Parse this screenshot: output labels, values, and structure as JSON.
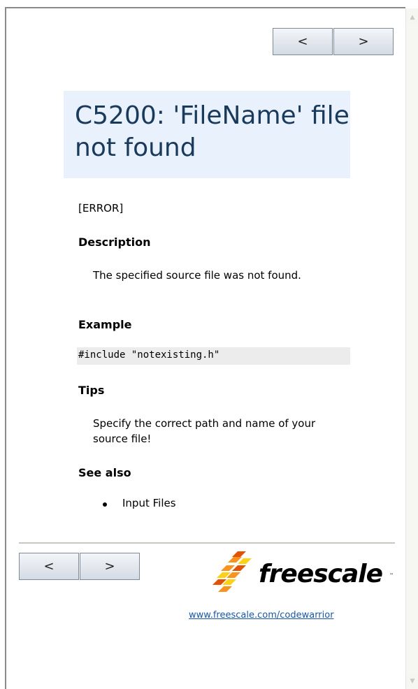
{
  "nav": {
    "prev_label": "<",
    "next_label": ">"
  },
  "title": "C5200: 'FileName' file not found",
  "error_tag": "[ERROR]",
  "description": {
    "heading": "Description",
    "text": "The specified source file was not found."
  },
  "example": {
    "heading": "Example",
    "code": "#include \"notexisting.h\""
  },
  "tips": {
    "heading": "Tips",
    "text": "Specify the correct path and name of your source file!"
  },
  "see_also": {
    "heading": "See also",
    "items": [
      "Input Files"
    ]
  },
  "footer": {
    "logo_text": "freescale",
    "logo_tm": "™",
    "link": "www.freescale.com/codewarrior"
  },
  "colors": {
    "title_bg": "#e8f1fc",
    "title_text": "#1a3a5c",
    "link": "#1a57a8",
    "logo_orange": "#f7931e",
    "logo_yellow": "#fcd116",
    "logo_red": "#e35205"
  }
}
